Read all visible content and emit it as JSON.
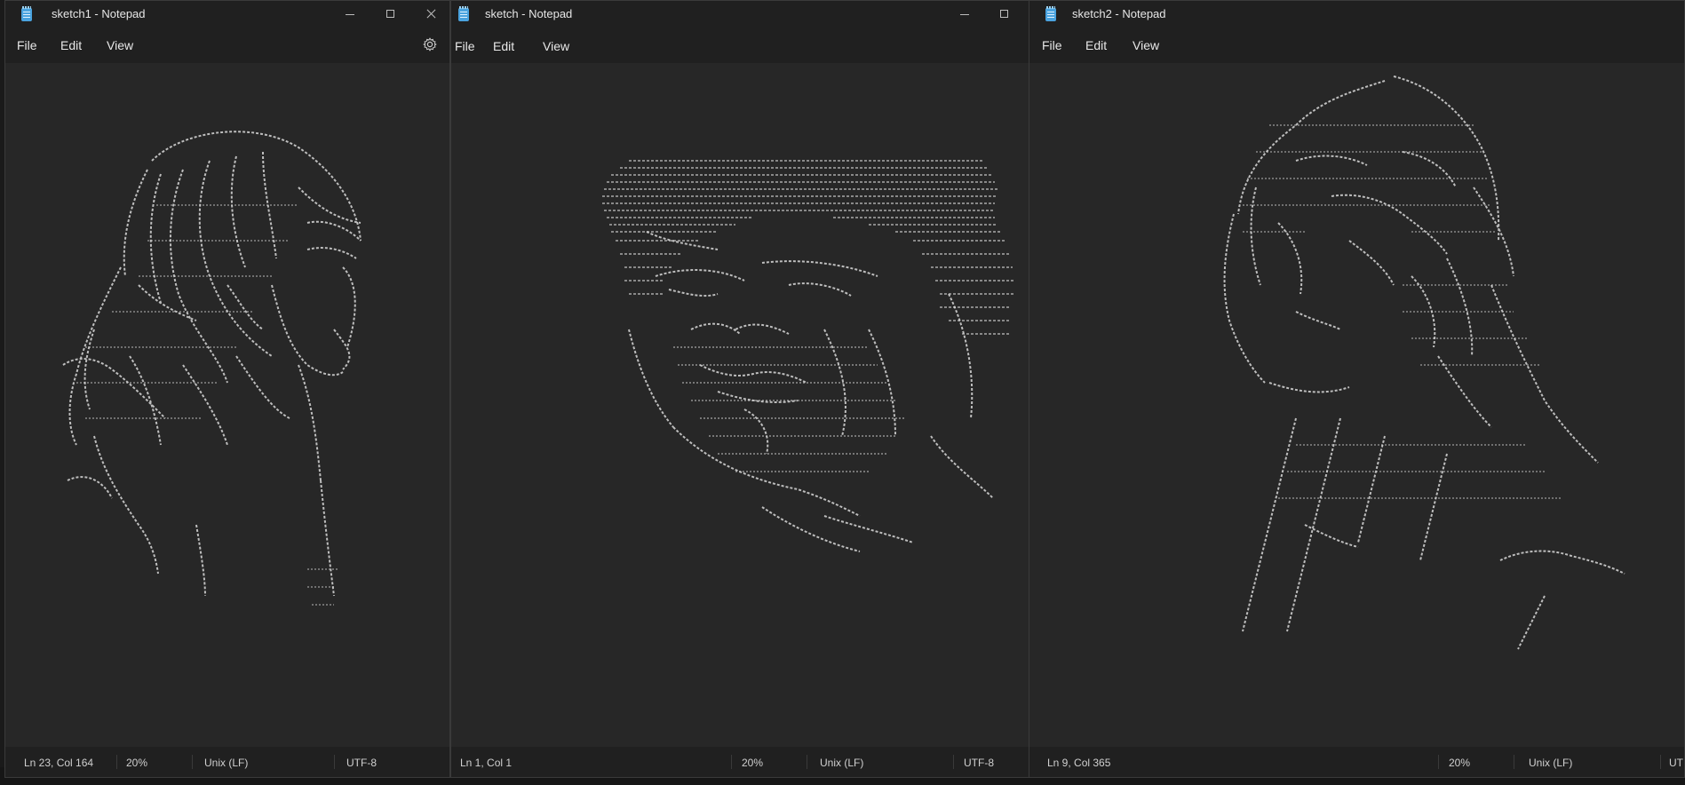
{
  "windows": [
    {
      "title": "sketch1 - Notepad",
      "menu": [
        "File",
        "Edit",
        "View"
      ],
      "status": {
        "position": "Ln 23, Col 164",
        "zoom": "20%",
        "line_ending": "Unix (LF)",
        "encoding": "UTF-8"
      }
    },
    {
      "title": "sketch - Notepad",
      "menu": [
        "File",
        "Edit",
        "View"
      ],
      "status": {
        "position": "Ln 1, Col 1",
        "zoom": "20%",
        "line_ending": "Unix (LF)",
        "encoding": "UTF-8"
      }
    },
    {
      "title": "sketch2 - Notepad",
      "menu": [
        "File",
        "Edit",
        "View"
      ],
      "status": {
        "position": "Ln 9, Col 365",
        "zoom": "20%",
        "line_ending": "Unix (LF)",
        "encoding": "UT"
      }
    }
  ],
  "icons": {
    "app": "notepad-icon",
    "settings": "gear-icon",
    "minimize": "minimize-icon",
    "maximize": "maximize-icon",
    "close": "close-icon"
  },
  "colors": {
    "window_bg": "#272727",
    "chrome_bg": "#202020",
    "text": "#e8e8e8",
    "ascii_art": "#d9d9d9"
  }
}
